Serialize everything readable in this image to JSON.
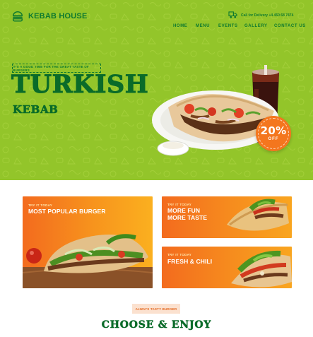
{
  "brand": {
    "name": "KEBAB HOUSE",
    "logo_icon": "burger-icon"
  },
  "header": {
    "delivery_icon": "delivery-truck-icon",
    "delivery_text": "Call for Delivery +4 450 68 7474"
  },
  "nav": {
    "items": [
      {
        "label": "HOME"
      },
      {
        "label": "MENU"
      },
      {
        "label": "EVENTS"
      },
      {
        "label": "GALLERY"
      },
      {
        "label": "CONTACT US"
      }
    ]
  },
  "hero": {
    "tagline": "IT'S A GOOD TIME FOR THE GREAT TASTE OF BURGERS",
    "title": "TURKISH",
    "subtitle": "KEBAB",
    "badge_pct": "20%",
    "badge_off": "OFF",
    "food_image": "kebab-plate-with-soda-image"
  },
  "promos": [
    {
      "kicker": "TRY IT TODAY",
      "title": "MOST POPULAR BURGER",
      "image": "doner-sandwich-image"
    },
    {
      "kicker": "TRY IT TODAY",
      "title": "MORE FUN\nMORE TASTE",
      "image": "wrap-image"
    },
    {
      "kicker": "TRY IT TODAY",
      "title": "FRESH & CHILI",
      "image": "salad-wrap-image"
    }
  ],
  "section": {
    "pill": "ALWAYS TASTY BURGER",
    "heading": "CHOOSE & ENJOY"
  },
  "colors": {
    "hero_bg": "#93c52a",
    "brand_green": "#0a6b29",
    "accent_orange": "#f4761e"
  }
}
